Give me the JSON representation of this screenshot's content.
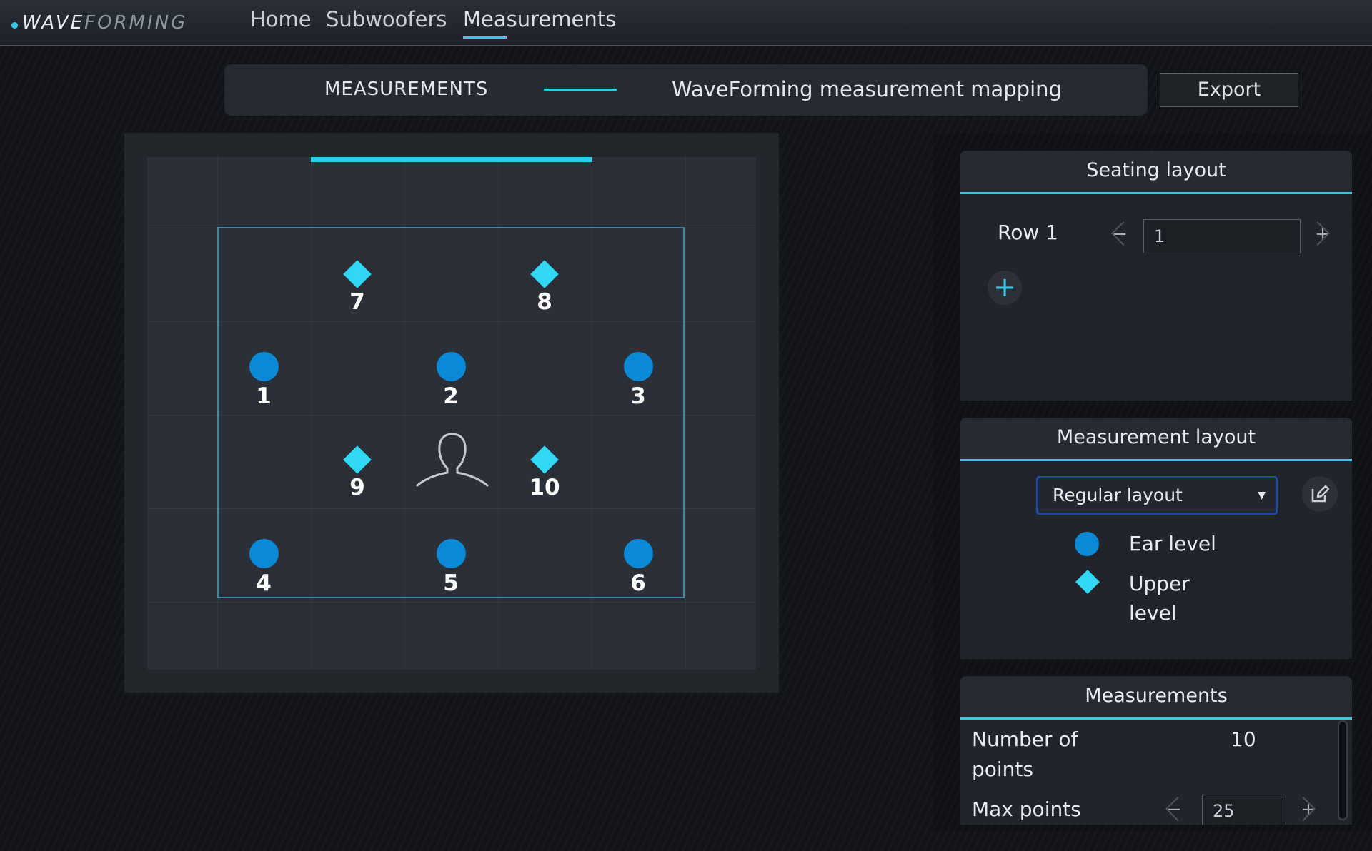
{
  "app": {
    "logo_a": "WAVE",
    "logo_b": "FORMING"
  },
  "nav": {
    "items": [
      {
        "label": "Home",
        "active": false
      },
      {
        "label": "Subwoofers",
        "active": false
      },
      {
        "label": "Measurements",
        "active": true
      }
    ]
  },
  "header": {
    "section": "MEASUREMENTS",
    "title": "WaveForming measurement mapping",
    "export_label": "Export"
  },
  "room": {
    "points": [
      {
        "id": "1",
        "level": "ear"
      },
      {
        "id": "2",
        "level": "ear"
      },
      {
        "id": "3",
        "level": "ear"
      },
      {
        "id": "4",
        "level": "ear"
      },
      {
        "id": "5",
        "level": "ear"
      },
      {
        "id": "6",
        "level": "ear"
      },
      {
        "id": "7",
        "level": "upper"
      },
      {
        "id": "8",
        "level": "upper"
      },
      {
        "id": "9",
        "level": "upper"
      },
      {
        "id": "10",
        "level": "upper"
      }
    ],
    "listener_icon": "person-outline-icon"
  },
  "seating": {
    "title": "Seating layout",
    "row_label": "Row 1",
    "row_value": "1",
    "minus": "−",
    "plus": "+",
    "add_icon": "plus-icon",
    "add_glyph": "+"
  },
  "measurement_layout": {
    "title": "Measurement layout",
    "selected": "Regular layout",
    "caret": "▼",
    "edit_icon": "edit-icon",
    "legend": [
      {
        "shape": "circle",
        "label": "Ear level"
      },
      {
        "shape": "diamond",
        "label": "Upper level"
      }
    ]
  },
  "measurements": {
    "title": "Measurements",
    "number_label": "Number of points",
    "number_value": "10",
    "max_label": "Max points",
    "max_value": "25",
    "minus": "−",
    "plus": "+"
  },
  "colors": {
    "accent": "#35c7e8",
    "ear_level": "#0a8ad6",
    "upper_level": "#31d8f3"
  }
}
